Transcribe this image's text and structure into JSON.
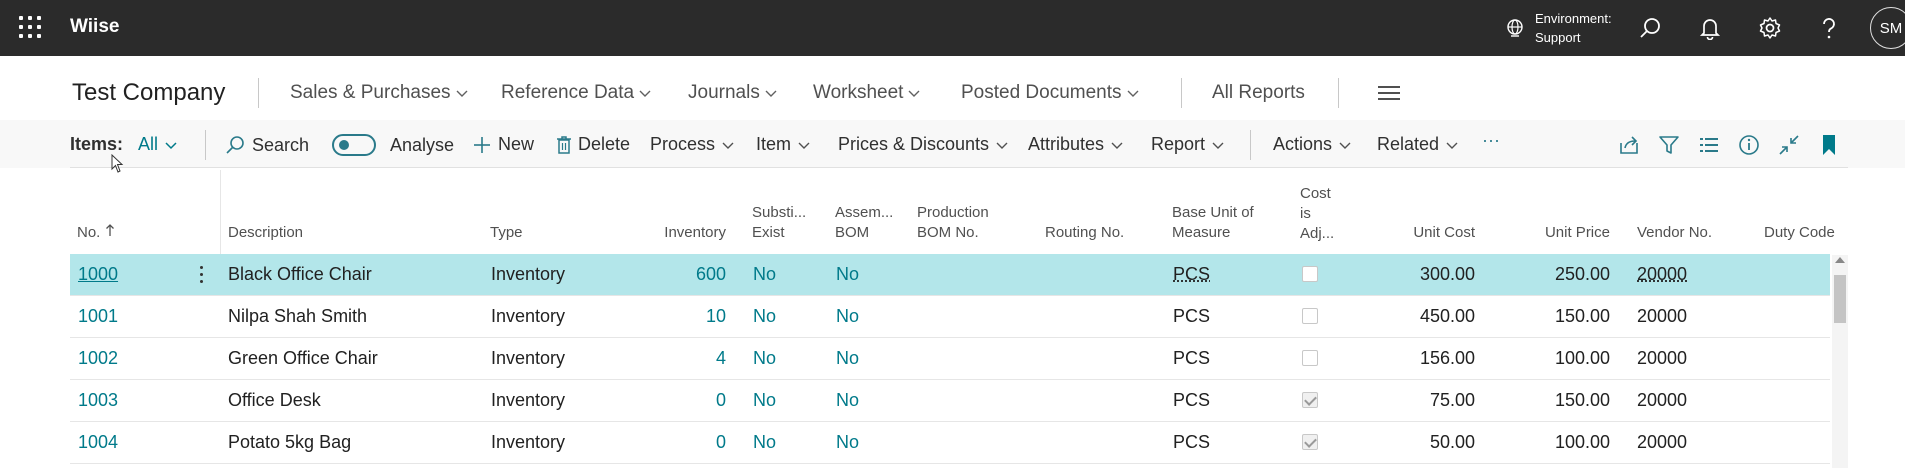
{
  "appbar": {
    "brand": "Wiise",
    "environment_label": "Environment:",
    "environment_value": "Support",
    "avatar_initials": "SM"
  },
  "company_nav": {
    "company": "Test Company",
    "items": [
      {
        "label": "Sales & Purchases"
      },
      {
        "label": "Reference Data"
      },
      {
        "label": "Journals"
      },
      {
        "label": "Worksheet"
      },
      {
        "label": "Posted Documents"
      }
    ],
    "all_reports": "All Reports"
  },
  "actionbar": {
    "items_label": "Items:",
    "filter_value": "All",
    "search": "Search",
    "analyse": "Analyse",
    "new": "New",
    "delete": "Delete",
    "process": "Process",
    "item": "Item",
    "prices_discounts": "Prices & Discounts",
    "attributes": "Attributes",
    "report": "Report",
    "actions": "Actions",
    "related": "Related",
    "more": "···"
  },
  "table": {
    "headers": {
      "no": "No.",
      "description": "Description",
      "type": "Type",
      "inventory": "Inventory",
      "subst_1": "Substi...",
      "subst_2": "Exist",
      "assem_1": "Assem...",
      "assem_2": "BOM",
      "prod_1": "Production",
      "prod_2": "BOM No.",
      "routing": "Routing No.",
      "base_1": "Base Unit of",
      "base_2": "Measure",
      "cost_1": "Cost",
      "cost_2": "is",
      "cost_3": "Adj...",
      "unit_cost": "Unit Cost",
      "unit_price": "Unit Price",
      "vendor": "Vendor No.",
      "duty": "Duty Code"
    },
    "rows": [
      {
        "no": "1000",
        "description": "Black Office Chair",
        "type": "Inventory",
        "inventory": "600",
        "subst": "No",
        "assem": "No",
        "base_unit": "PCS",
        "cost_adj": false,
        "unit_cost": "300.00",
        "unit_price": "250.00",
        "vendor": "20000"
      },
      {
        "no": "1001",
        "description": "Nilpa Shah Smith",
        "type": "Inventory",
        "inventory": "10",
        "subst": "No",
        "assem": "No",
        "base_unit": "PCS",
        "cost_adj": false,
        "unit_cost": "450.00",
        "unit_price": "150.00",
        "vendor": "20000"
      },
      {
        "no": "1002",
        "description": "Green Office Chair",
        "type": "Inventory",
        "inventory": "4",
        "subst": "No",
        "assem": "No",
        "base_unit": "PCS",
        "cost_adj": false,
        "unit_cost": "156.00",
        "unit_price": "100.00",
        "vendor": "20000"
      },
      {
        "no": "1003",
        "description": "Office Desk",
        "type": "Inventory",
        "inventory": "0",
        "subst": "No",
        "assem": "No",
        "base_unit": "PCS",
        "cost_adj": true,
        "unit_cost": "75.00",
        "unit_price": "150.00",
        "vendor": "20000"
      },
      {
        "no": "1004",
        "description": "Potato 5kg Bag",
        "type": "Inventory",
        "inventory": "0",
        "subst": "No",
        "assem": "No",
        "base_unit": "PCS",
        "cost_adj": true,
        "unit_cost": "50.00",
        "unit_price": "100.00",
        "vendor": "20000"
      }
    ]
  },
  "colors": {
    "accent": "#007a8a",
    "selected_row": "#b3e6ea",
    "appbar": "#2b2b2b"
  }
}
